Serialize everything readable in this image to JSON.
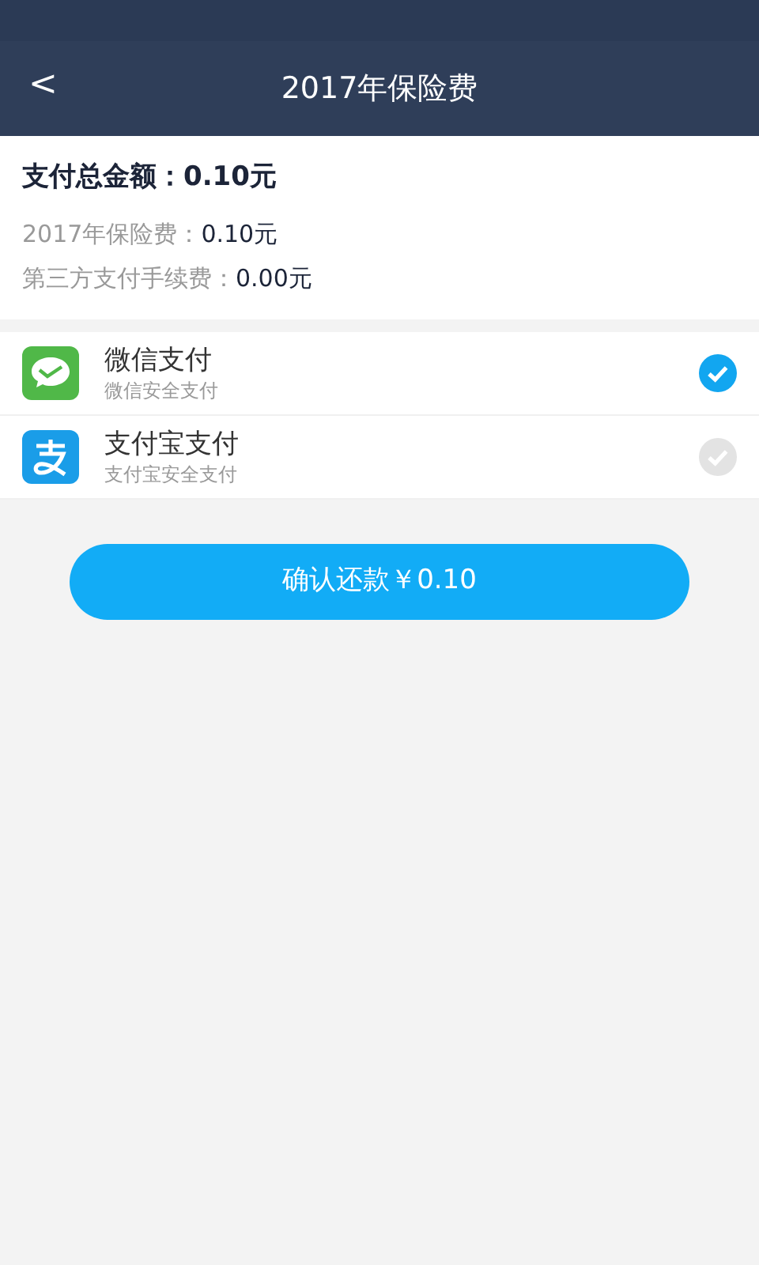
{
  "header": {
    "back": "<",
    "title": "2017年保险费"
  },
  "summary": {
    "total_label": "支付总金额：",
    "total_value": "0.10元",
    "lines": [
      {
        "label": "2017年保险费：",
        "value": "0.10元"
      },
      {
        "label": "第三方支付手续费：",
        "value": "0.00元"
      }
    ]
  },
  "payment_methods": [
    {
      "kind": "wechat",
      "name": "微信支付",
      "subtitle": "微信安全支付",
      "selected": true
    },
    {
      "kind": "alipay",
      "name": "支付宝支付",
      "subtitle": "支付宝安全支付",
      "selected": false
    }
  ],
  "confirm_button": "确认还款￥0.10"
}
